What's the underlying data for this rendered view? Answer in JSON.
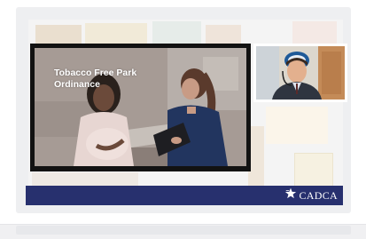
{
  "video": {
    "title_line1": "Tobacco Free Park",
    "title_line2": "Ordinance"
  },
  "webcam": {
    "description": "presenter-webcam"
  },
  "brand": {
    "logo_text": "CADCA",
    "accent": "#27306e",
    "star_color": "#ffffff"
  },
  "icons": {
    "star": "star-icon"
  }
}
